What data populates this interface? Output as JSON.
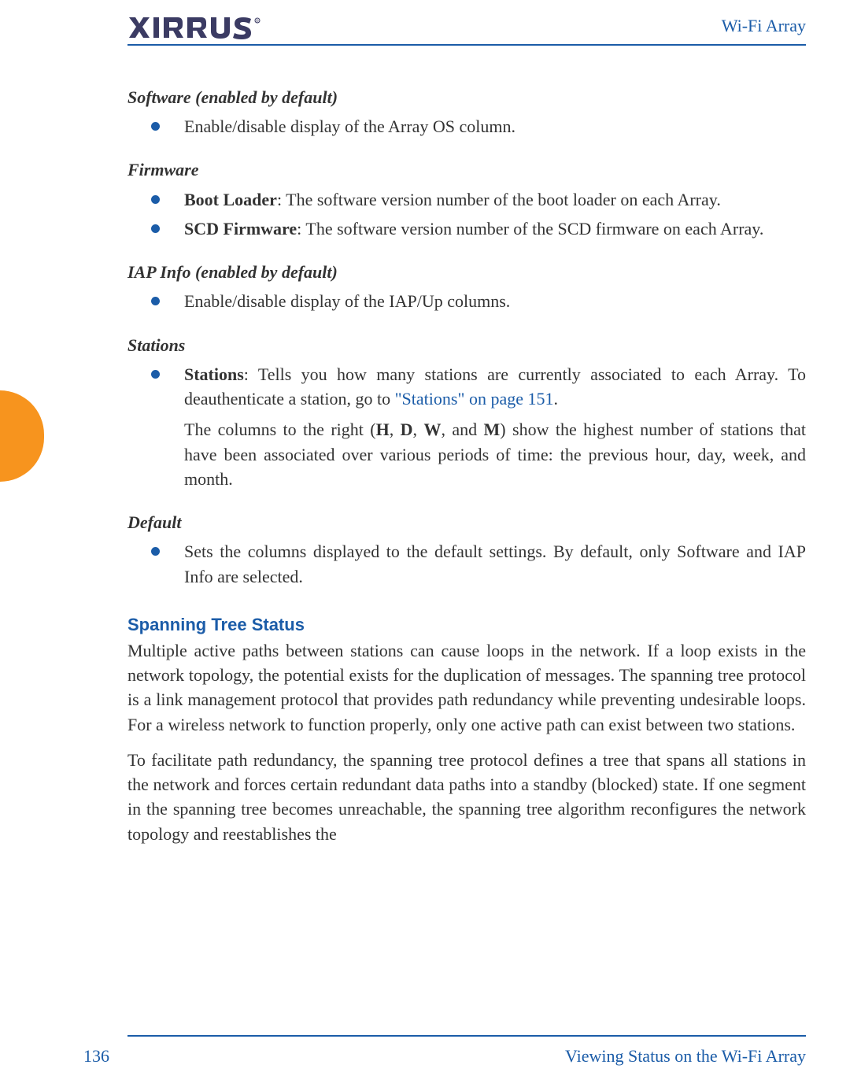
{
  "header": {
    "title": "Wi-Fi Array",
    "logo_text": "XIRRUS"
  },
  "footer": {
    "page_number": "136",
    "section_title": "Viewing Status on the Wi-Fi Array"
  },
  "sections": {
    "software": {
      "heading": "Software (enabled by default)",
      "bullet1": "Enable/disable display of the Array OS column."
    },
    "firmware": {
      "heading": "Firmware",
      "b1_label": "Boot Loader",
      "b1_text": ": The software version number of the boot loader on each Array.",
      "b2_label": "SCD Firmware",
      "b2_text": ": The software version number of the SCD firmware on each Array."
    },
    "iap": {
      "heading": "IAP Info (enabled by default)",
      "bullet1": "Enable/disable display of the IAP/Up columns."
    },
    "stations": {
      "heading": "Stations",
      "b1_label": "Stations",
      "b1_text1": ": Tells you how many stations are currently associated to each Array. To deauthenticate a station, go to ",
      "b1_link": "\"Stations\" on page 151",
      "b1_text2": ".",
      "p2_a": "The columns to the right (",
      "p2_H": "H",
      "p2_c1": ", ",
      "p2_D": "D",
      "p2_c2": ", ",
      "p2_W": "W",
      "p2_c3": ", and ",
      "p2_M": "M",
      "p2_b": ") show the highest number of stations that have been associated over various periods of time: the previous hour, day, week, and month."
    },
    "default": {
      "heading": "Default",
      "bullet1": "Sets the columns displayed to the default settings. By default, only Software and IAP Info are selected."
    },
    "spanning": {
      "heading": "Spanning Tree Status",
      "p1": "Multiple active paths between stations can cause loops in the network. If a loop exists in the network topology, the potential exists for the duplication of messages. The spanning tree protocol is a link management protocol that provides path redundancy while preventing undesirable loops. For a wireless network to function properly, only one active path can exist between two stations.",
      "p2": "To facilitate path redundancy, the spanning tree protocol defines a tree that spans all stations in the network and forces certain redundant data paths into a standby (blocked) state. If one segment in the spanning tree becomes unreachable, the spanning tree algorithm reconfigures the network topology and reestablishes the"
    }
  }
}
